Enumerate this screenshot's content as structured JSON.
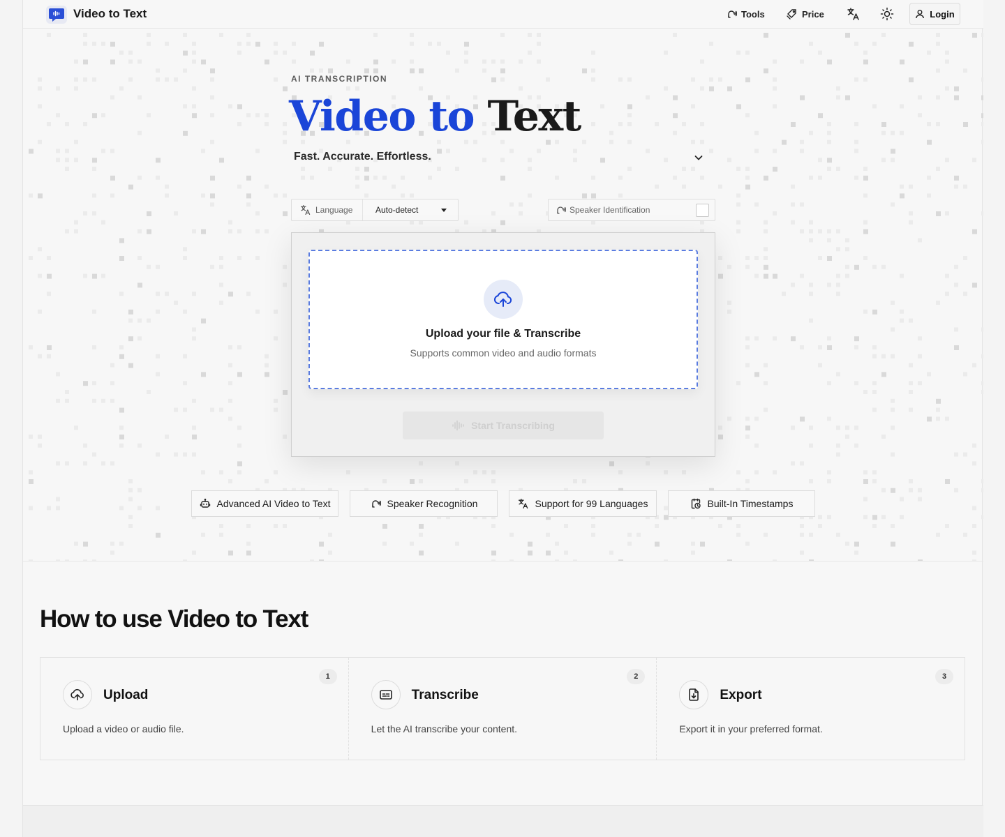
{
  "header": {
    "brand": "Video to Text",
    "nav": {
      "tools": "Tools",
      "price": "Price",
      "login": "Login"
    }
  },
  "hero": {
    "eyebrow": "AI TRANSCRIPTION",
    "title_part1": "Video to",
    "title_part2": "Text",
    "subtitle": "Fast. Accurate. Effortless.",
    "language_label": "Language",
    "language_value": "Auto-detect",
    "speaker_label": "Speaker Identification",
    "speaker_checked": false,
    "upload_title": "Upload your file & Transcribe",
    "upload_sub": "Supports common video and audio formats",
    "start_button": "Start Transcribing",
    "features": [
      {
        "label": "Advanced AI Video to Text",
        "icon": "robot-icon"
      },
      {
        "label": "Speaker Recognition",
        "icon": "speaker-icon"
      },
      {
        "label": "Support for 99 Languages",
        "icon": "translate-icon"
      },
      {
        "label": "Built-In Timestamps",
        "icon": "timestamp-icon"
      }
    ]
  },
  "howto": {
    "heading": "How to use Video to Text",
    "steps": [
      {
        "num": "1",
        "title": "Upload",
        "desc": "Upload a video or audio file.",
        "icon": "upload-cloud-icon"
      },
      {
        "num": "2",
        "title": "Transcribe",
        "desc": "Let the AI transcribe your content.",
        "icon": "captions-icon"
      },
      {
        "num": "3",
        "title": "Export",
        "desc": "Export it in your preferred format.",
        "icon": "file-download-icon"
      }
    ]
  },
  "colors": {
    "accent": "#1a45d8",
    "dropzone_border": "#5a7ce0"
  }
}
